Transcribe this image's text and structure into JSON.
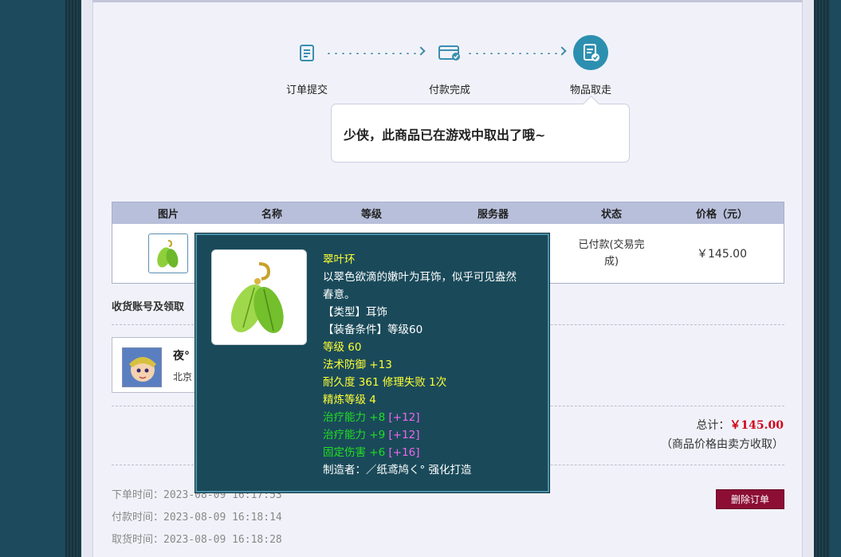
{
  "steps": [
    {
      "label": "订单提交",
      "icon": "clipboard-icon"
    },
    {
      "label": "付款完成",
      "icon": "card-check-icon"
    },
    {
      "label": "物品取走",
      "icon": "document-check-icon"
    }
  ],
  "bubble": {
    "message": "少侠，此商品已在游戏中取出了哦~"
  },
  "table": {
    "headers": [
      "图片",
      "名称",
      "等级",
      "服务器",
      "状态",
      "价格（元）"
    ],
    "row": {
      "status": "已付款(交易完成)",
      "status_line1": "已付款(交易完",
      "status_line2": "成)",
      "price": "￥145.00"
    }
  },
  "account": {
    "section_title": "收货账号及领取",
    "name": "夜°",
    "server": "北京"
  },
  "total": {
    "label": "总计：",
    "amount": "￥145.00",
    "note": "（商品价格由卖方收取）"
  },
  "times": [
    {
      "label": "下单时间：",
      "value": "2023-08-09 16:17:53"
    },
    {
      "label": "付款时间：",
      "value": "2023-08-09 16:18:14"
    },
    {
      "label": "取货时间：",
      "value": "2023-08-09 16:18:28"
    }
  ],
  "delete_button": "删除订单",
  "tooltip": {
    "name": "翠叶环",
    "desc_line1": "以翠色欲滴的嫩叶为耳饰，似乎可见盎然",
    "desc_line2": "春意。",
    "type": "【类型】耳饰",
    "equip_req": "【装备条件】等级60",
    "level": "等级 60",
    "magic_def": "法术防御 +13",
    "durability": "耐久度 361 修理失败 1次",
    "refine": "精炼等级 4",
    "heal1": "治疗能力 +8",
    "heal1_bonus": "[+12]",
    "heal2": "治疗能力 +9",
    "heal2_bonus": "[+12]",
    "fixed_dmg": "固定伤害 +6",
    "fixed_dmg_bonus": "[+16]",
    "maker": "制造者：／纸鸢鸠く° 强化打造"
  },
  "colors": {
    "accent": "#2d8fb0",
    "delete": "#8c0e35",
    "price_red": "#d0021b",
    "tooltip_bg": "#1a4a5a"
  }
}
